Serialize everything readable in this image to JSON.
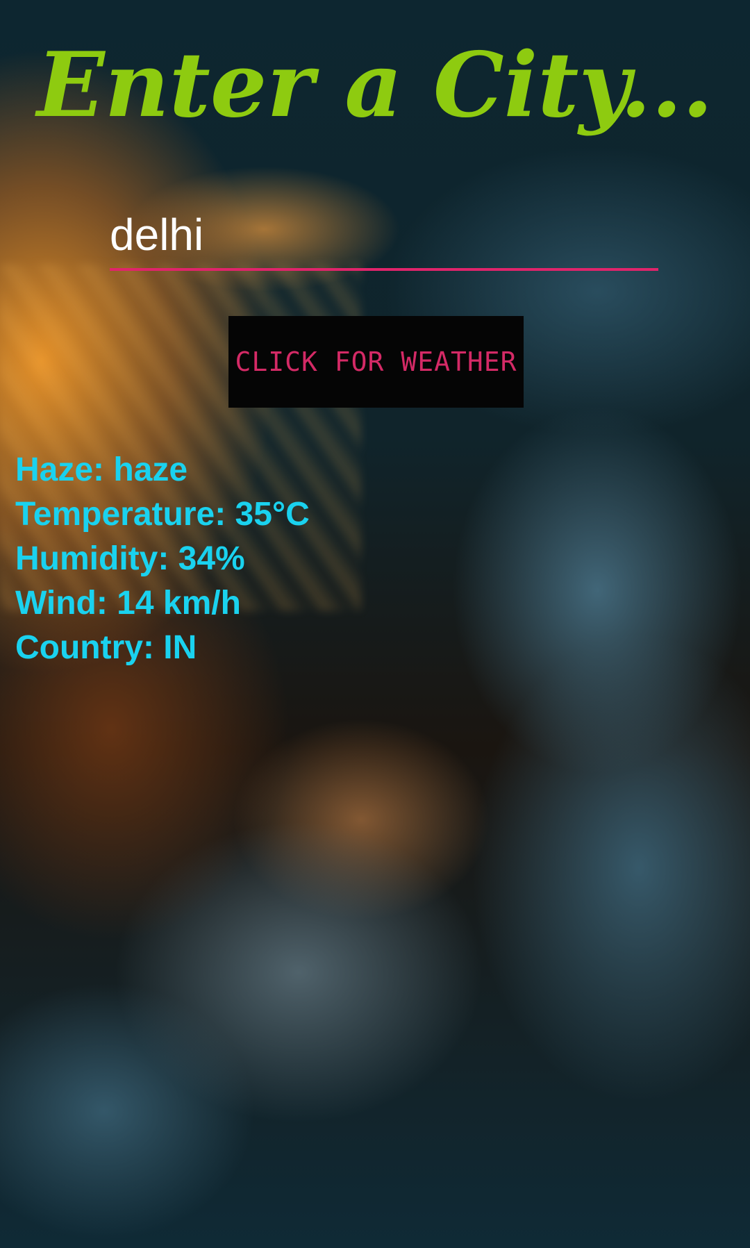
{
  "page": {
    "title": "Enter a City...",
    "background": "cloudy-sunset-sky-image"
  },
  "search": {
    "value": "delhi",
    "placeholder": ""
  },
  "button": {
    "label": "CLICK FOR WEATHER"
  },
  "weather": {
    "condition": "Haze: haze",
    "temperature": "Temperature: 35°C",
    "humidity": "Humidity: 34%",
    "wind": "Wind: 14 km/h",
    "country": "Country: IN"
  },
  "colors": {
    "title": "#8ecb10",
    "accent": "#e0246b",
    "button_text": "#d42a66",
    "button_bg": "#050505",
    "results": "#1ad2ef"
  }
}
